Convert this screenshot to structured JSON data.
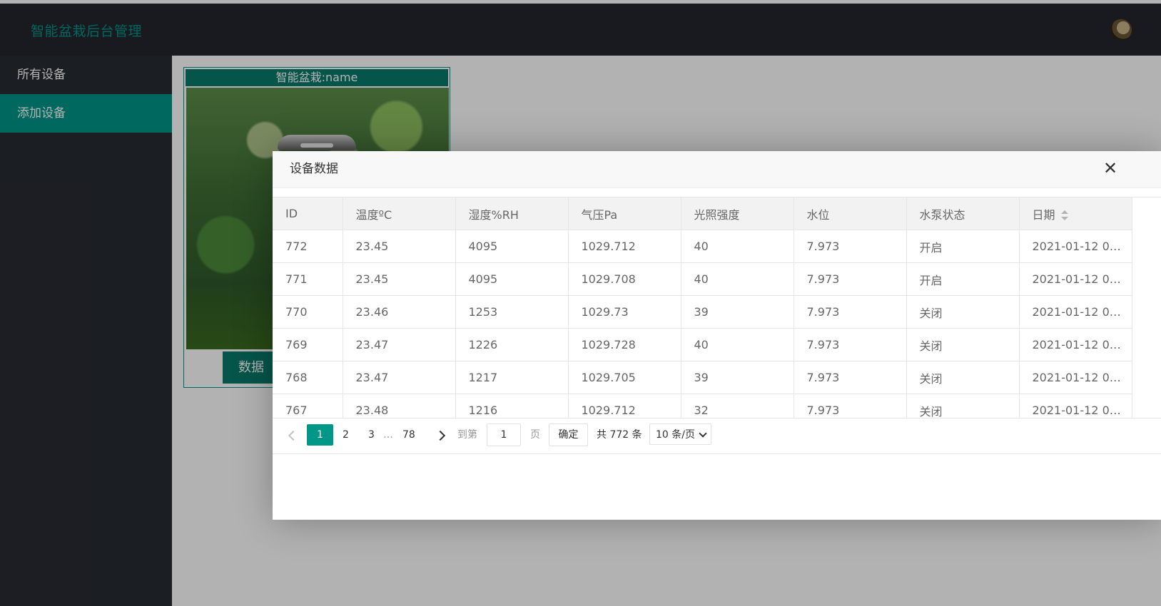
{
  "app": {
    "title": "智能盆栽后台管理"
  },
  "sidebar": {
    "items": [
      {
        "label": "所有设备"
      },
      {
        "label": "添加设备"
      }
    ]
  },
  "card": {
    "title": "智能盆栽:name",
    "button_label": "数据"
  },
  "modal": {
    "title": "设备数据",
    "close_icon": "✕"
  },
  "table": {
    "columns": [
      "ID",
      "温度ºC",
      "湿度%RH",
      "气压Pa",
      "光照强度",
      "水位",
      "水泵状态",
      "日期"
    ],
    "rows": [
      [
        "772",
        "23.45",
        "4095",
        "1029.712",
        "40",
        "7.973",
        "开启",
        "2021-01-12 0…"
      ],
      [
        "771",
        "23.45",
        "4095",
        "1029.708",
        "40",
        "7.973",
        "开启",
        "2021-01-12 0…"
      ],
      [
        "770",
        "23.46",
        "1253",
        "1029.73",
        "39",
        "7.973",
        "关闭",
        "2021-01-12 0…"
      ],
      [
        "769",
        "23.47",
        "1226",
        "1029.728",
        "40",
        "7.973",
        "关闭",
        "2021-01-12 0…"
      ],
      [
        "768",
        "23.47",
        "1217",
        "1029.705",
        "39",
        "7.973",
        "关闭",
        "2021-01-12 0…"
      ],
      [
        "767",
        "23.48",
        "1216",
        "1029.712",
        "32",
        "7.973",
        "关闭",
        "2021-01-12 0…"
      ]
    ]
  },
  "pagination": {
    "pages": [
      "1",
      "2",
      "3"
    ],
    "ellipsis": "…",
    "last_page": "78",
    "goto_label": "到第",
    "goto_value": "1",
    "page_unit": "页",
    "confirm_label": "确定",
    "total_label": "共 772 条",
    "page_size": "10 条/页",
    "page_size_options": [
      "10 条/页"
    ]
  },
  "colors": {
    "accent": "#009688",
    "header_bg": "#23262e",
    "sidebar_bg": "#282b33"
  }
}
